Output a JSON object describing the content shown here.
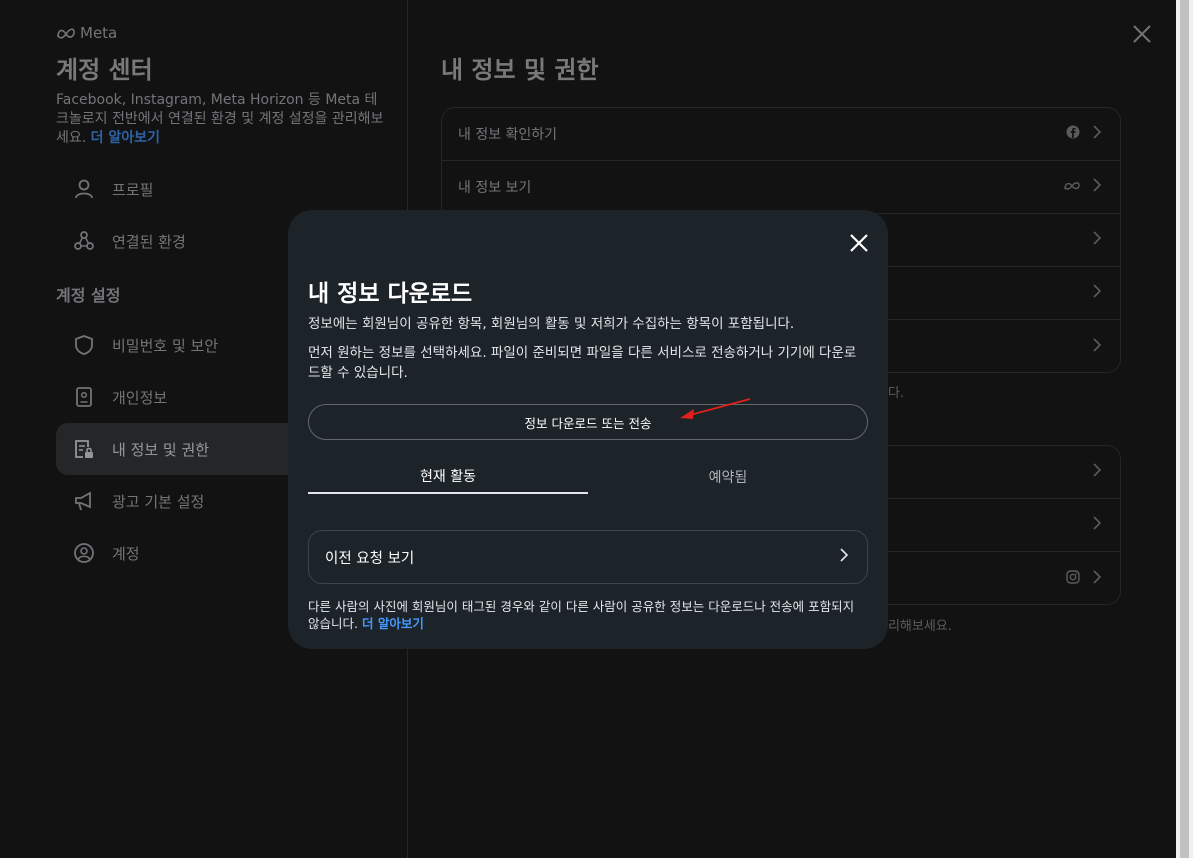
{
  "sidebar": {
    "brand": "Meta",
    "title": "계정 센터",
    "description": "Facebook, Instagram, Meta Horizon 등 Meta 테크놀로지 전반에서 연결된 환경 및 계정 설정을 관리해보세요.",
    "learn_more": "더 알아보기",
    "section_label": "계정 설정",
    "items": [
      {
        "label": "프로필",
        "icon": "person-icon"
      },
      {
        "label": "연결된 환경",
        "icon": "connected-icon"
      },
      {
        "label": "비밀번호 및 보안",
        "icon": "shield-icon"
      },
      {
        "label": "개인정보",
        "icon": "id-card-icon"
      },
      {
        "label": "내 정보 및 권한",
        "icon": "info-lock-icon"
      },
      {
        "label": "광고 기본 설정",
        "icon": "megaphone-icon"
      },
      {
        "label": "계정",
        "icon": "account-icon"
      }
    ],
    "active_index": 4
  },
  "main": {
    "title": "내 정보 및 권한",
    "card1_rows": [
      "내 정보 확인하기",
      "내 정보 보기",
      "",
      "",
      ""
    ],
    "ghost_text_1": "다.",
    "ghost_text_2": "관리해보세요."
  },
  "modal": {
    "title": "내 정보 다운로드",
    "paragraph1": "정보에는 회원님이 공유한 항목, 회원님의 활동 및 저희가 수집하는 항목이 포함됩니다.",
    "paragraph2": "먼저 원하는 정보를 선택하세요. 파일이 준비되면 파일을 다른 서비스로 전송하거나 기기에 다운로드할 수 있습니다.",
    "download_button": "정보 다운로드 또는 전송",
    "tabs": [
      "현재 활동",
      "예약됨"
    ],
    "active_tab": 0,
    "history_label": "이전 요청 보기",
    "footnote": "다른 사람의 사진에 회원님이 태그된 경우와 같이 다른 사람이 공유한 정보는 다운로드나 전송에 포함되지 않습니다.",
    "footnote_link": "더 알아보기"
  },
  "colors": {
    "accent": "#4599ff",
    "modal_bg": "#1c2329",
    "annotation_arrow": "#e0211b"
  }
}
